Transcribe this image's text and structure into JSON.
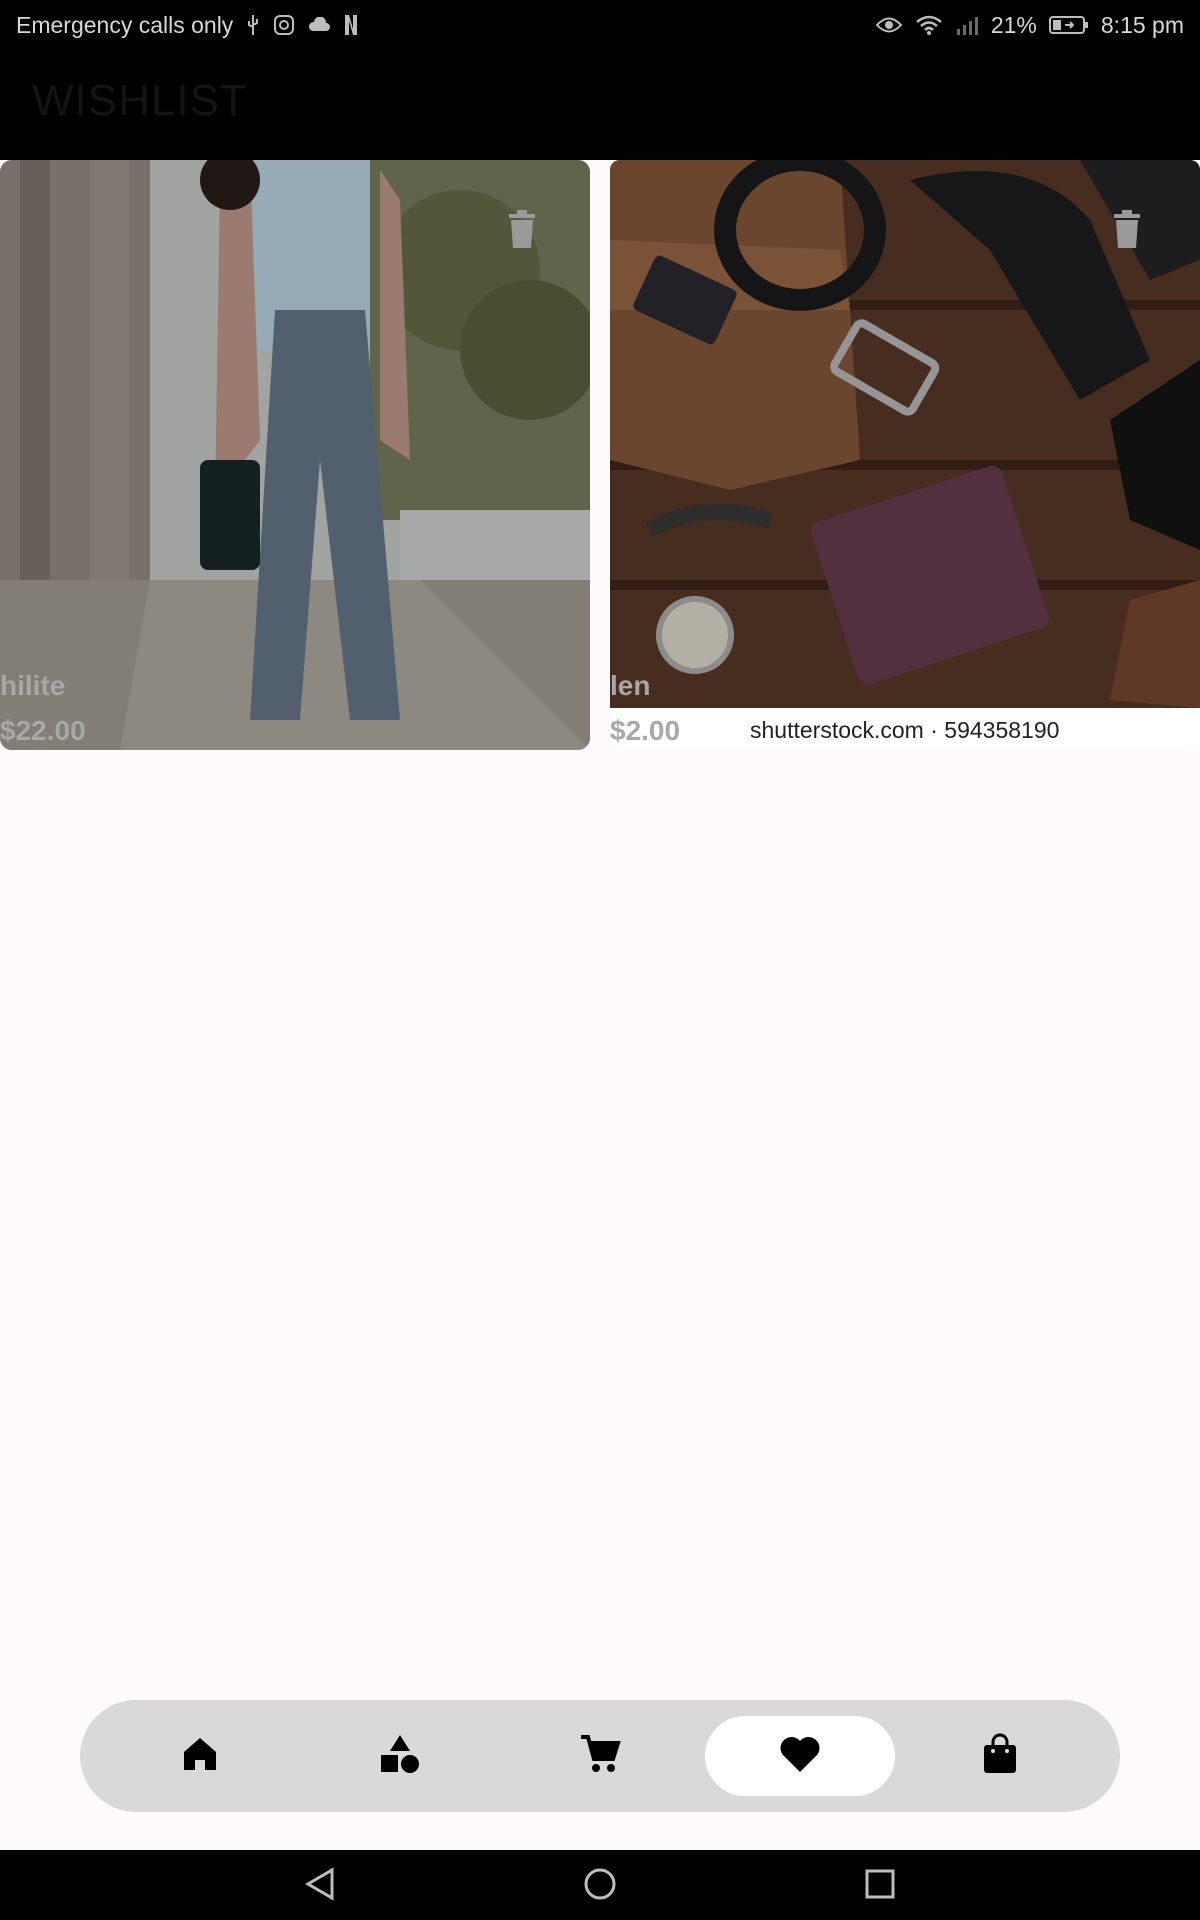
{
  "status_bar": {
    "carrier_text": "Emergency calls only",
    "battery_percent": "21%",
    "time": "8:15 pm",
    "icons_left": [
      "usb-icon",
      "instagram-icon",
      "cloud-icon",
      "netflix-icon"
    ],
    "icons_right": [
      "eye-icon",
      "wifi-icon",
      "signal-icon",
      "battery-icon"
    ]
  },
  "app_bar": {
    "title": "WISHLIST"
  },
  "wishlist": {
    "items": [
      {
        "name": "hilite",
        "price": "$22.00"
      },
      {
        "name": "len",
        "price": "$2.00",
        "watermark": "shutterstock.com · 594358190"
      }
    ]
  },
  "bottom_nav": {
    "items": [
      {
        "icon": "home-icon",
        "active": false
      },
      {
        "icon": "categories-icon",
        "active": false
      },
      {
        "icon": "cart-icon",
        "active": false
      },
      {
        "icon": "heart-icon",
        "active": true
      },
      {
        "icon": "shopping-bag-icon",
        "active": false
      }
    ]
  },
  "system_nav": {
    "buttons": [
      "back-icon",
      "home-circle-icon",
      "recents-icon"
    ]
  },
  "colors": {
    "status_bar_bg": "#000000",
    "app_bar_bg": "#000000",
    "page_bg": "#fffafd",
    "nav_pill_bg": "#d9d9d9",
    "nav_active_bg": "#ffffff"
  }
}
